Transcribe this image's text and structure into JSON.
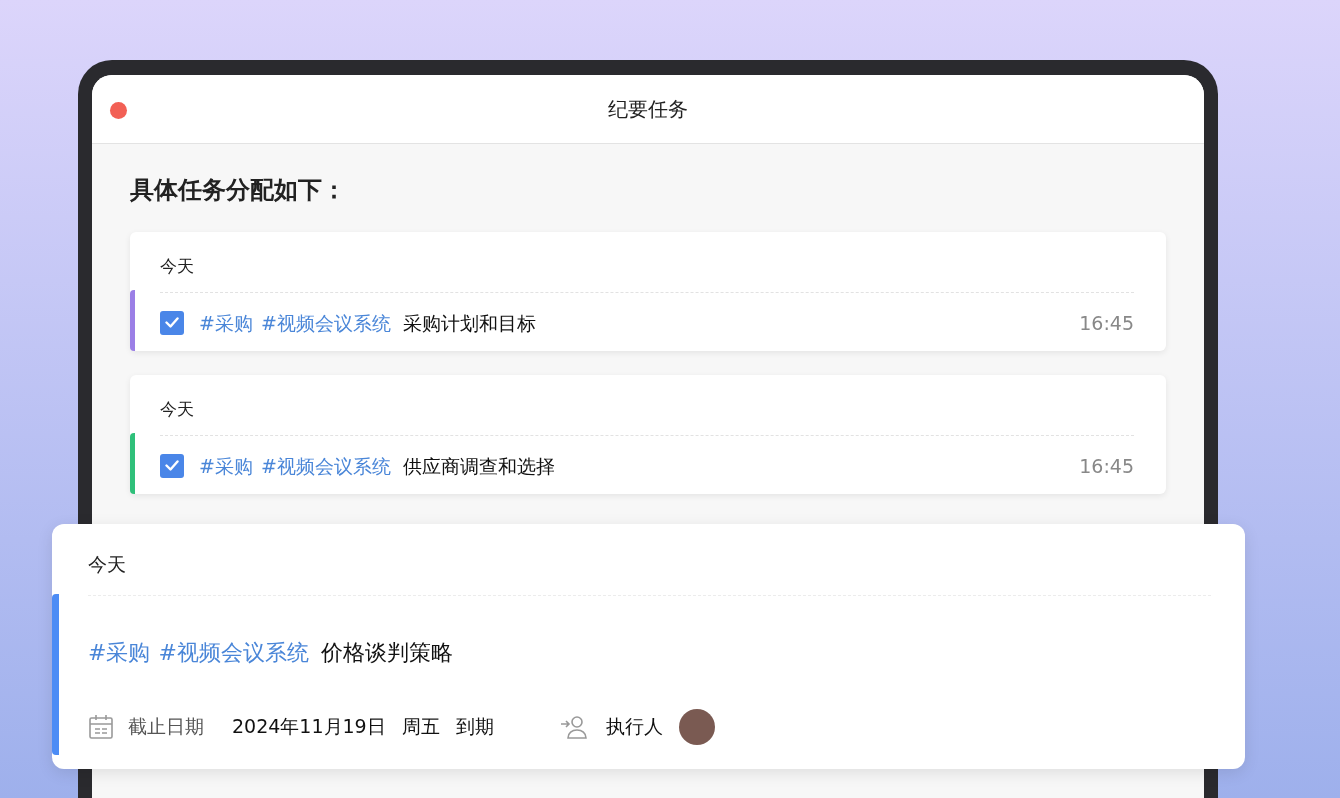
{
  "window": {
    "title": "纪要任务"
  },
  "heading": "具体任务分配如下：",
  "tasks": [
    {
      "date": "今天",
      "checked": true,
      "color": "#9b7fe6",
      "tags": [
        "#采购",
        "#视频会议系统"
      ],
      "title": "采购计划和目标",
      "time": "16:45"
    },
    {
      "date": "今天",
      "checked": true,
      "color": "#2fc07a",
      "tags": [
        "#采购",
        "#视频会议系统"
      ],
      "title": "供应商调查和选择",
      "time": "16:45"
    }
  ],
  "detail_card": {
    "date": "今天",
    "color": "#4c8cf5",
    "tags": [
      "#采购",
      "#视频会议系统"
    ],
    "title": "价格谈判策略",
    "due_label": "截止日期",
    "due_date": "2024年11月19日",
    "due_weekday": "周五",
    "due_status": "到期",
    "assignee_label": "执行人"
  }
}
